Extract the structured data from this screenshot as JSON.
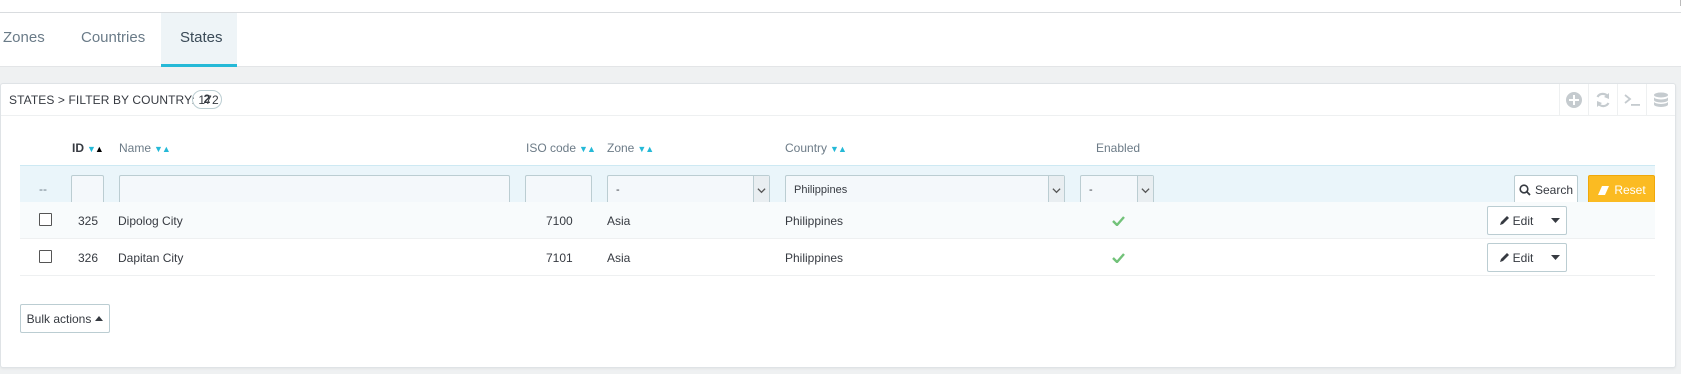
{
  "tabs": [
    {
      "label": "Zones",
      "active": false
    },
    {
      "label": "Countries",
      "active": false
    },
    {
      "label": "States",
      "active": true
    }
  ],
  "panel": {
    "title": "STATES > FILTER BY COUNTRY: 172",
    "count": "2",
    "tools": [
      "add-icon",
      "refresh-icon",
      "sql-icon",
      "database-icon"
    ]
  },
  "table": {
    "columns": {
      "id": "ID",
      "name": "Name",
      "iso": "ISO code",
      "zone": "Zone",
      "country": "Country",
      "enabled": "Enabled"
    },
    "filters": {
      "bulk_placeholder": "--",
      "id_value": "",
      "name_value": "",
      "iso_value": "",
      "zone_selected": "-",
      "country_selected": "Philippines",
      "enabled_selected": "-"
    },
    "rows": [
      {
        "id": "325",
        "name": "Dipolog City",
        "iso": "7100",
        "zone": "Asia",
        "country": "Philippines",
        "enabled": true
      },
      {
        "id": "326",
        "name": "Dapitan City",
        "iso": "7101",
        "zone": "Asia",
        "country": "Philippines",
        "enabled": true
      }
    ]
  },
  "buttons": {
    "search": "Search",
    "reset": "Reset",
    "edit": "Edit",
    "bulk": "Bulk actions"
  },
  "colors": {
    "accent": "#25b9d7",
    "reset": "#fbbb22",
    "check": "#72c279"
  }
}
